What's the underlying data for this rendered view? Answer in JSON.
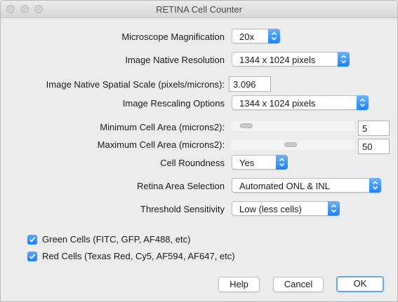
{
  "window": {
    "title": "RETINA Cell Counter"
  },
  "form": {
    "magnification": {
      "label": "Microscope Magnification",
      "value": "20x"
    },
    "native_resolution": {
      "label": "Image Native Resolution",
      "value": "1344 x 1024 pixels"
    },
    "spatial_scale": {
      "label": "Image Native Spatial Scale (pixels/microns):",
      "value": "3.096"
    },
    "rescaling": {
      "label": "Image Rescaling Options",
      "value": "1344 x 1024 pixels"
    },
    "min_area": {
      "label": "Minimum Cell Area (microns2):",
      "value": "5"
    },
    "max_area": {
      "label": "Maximum Cell Area (microns2):",
      "value": "50"
    },
    "roundness": {
      "label": "Cell Roundness",
      "value": "Yes"
    },
    "area_selection": {
      "label": "Retina Area Selection",
      "value": "Automated ONL & INL"
    },
    "threshold": {
      "label": "Threshold Sensitivity",
      "value": "Low (less cells)"
    }
  },
  "checkboxes": {
    "green": {
      "label": "Green Cells (FITC, GFP, AF488, etc)",
      "checked": true
    },
    "red": {
      "label": "Red Cells (Texas Red, Cy5, AF594, AF647, etc)",
      "checked": true
    }
  },
  "buttons": {
    "help": "Help",
    "cancel": "Cancel",
    "ok": "OK"
  },
  "colors": {
    "accent": "#1a82fb",
    "default_button_border": "#6aa6ea"
  }
}
